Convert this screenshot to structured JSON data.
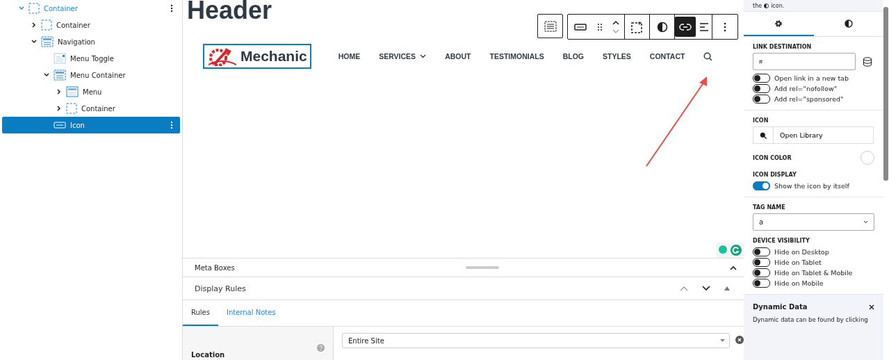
{
  "tree": [
    {
      "label": "Container",
      "kind": "container",
      "expanded": true,
      "selected": false,
      "children": [
        {
          "label": "Container",
          "kind": "container",
          "expanded": false,
          "selected": false
        },
        {
          "label": "Navigation",
          "kind": "navigation",
          "expanded": true,
          "selected": false,
          "children": [
            {
              "label": "Menu Toggle",
              "kind": "menu-toggle",
              "selected": false
            },
            {
              "label": "Menu Container",
              "kind": "navigation",
              "expanded": true,
              "selected": false,
              "children": [
                {
                  "label": "Menu",
                  "kind": "menu",
                  "expanded": false,
                  "selected": false
                },
                {
                  "label": "Container",
                  "kind": "container",
                  "expanded": false,
                  "selected": false
                }
              ]
            },
            {
              "label": "Icon",
              "kind": "icon",
              "selected": true
            }
          ]
        }
      ]
    }
  ],
  "canvas": {
    "heading": "Header",
    "toolbar": [
      {
        "kind": "navigation",
        "selected": false
      },
      {
        "kind": "icon-block",
        "selected": false
      },
      {
        "kind": "drag",
        "selected": false
      },
      {
        "kind": "move",
        "selected": false
      },
      {
        "kind": "select-parent",
        "selected": false
      },
      {
        "kind": "contrast",
        "selected": false
      },
      {
        "kind": "link",
        "selected": true
      },
      {
        "kind": "align",
        "selected": false
      },
      {
        "kind": "more",
        "selected": false
      }
    ],
    "logo": "Mechanic",
    "menu": [
      {
        "label": "HOME",
        "dropdown": false
      },
      {
        "label": "SERVICES",
        "dropdown": true
      },
      {
        "label": "ABOUT",
        "dropdown": false
      },
      {
        "label": "TESTIMONIALS",
        "dropdown": false
      },
      {
        "label": "BLOG",
        "dropdown": false
      },
      {
        "label": "STYLES",
        "dropdown": false
      },
      {
        "label": "CONTACT",
        "dropdown": false
      }
    ]
  },
  "meta_boxes": {
    "title": "Meta Boxes",
    "panel_title": "Display Rules",
    "tabs": [
      {
        "label": "Rules",
        "selected": true
      },
      {
        "label": "Internal Notes",
        "selected": false
      }
    ],
    "location_label": "Location",
    "location_value": "Entire Site"
  },
  "inspector": {
    "note_start": "the",
    "note_end": "icon.",
    "tabs": [
      {
        "kind": "settings",
        "selected": true
      },
      {
        "kind": "styles",
        "selected": false
      }
    ],
    "link_heading": "LINK DESTINATION",
    "link_value": "#",
    "link_toggles": [
      {
        "label": "Open link in a new tab",
        "on": false
      },
      {
        "label": "Add rel=\"nofollow\"",
        "on": false
      },
      {
        "label": "Add rel=\"sponsored\"",
        "on": false
      }
    ],
    "icon_heading": "ICON",
    "icon_button": "Open Library",
    "color_heading": "ICON COLOR",
    "display_heading": "ICON DISPLAY",
    "display_toggle": {
      "label": "Show the icon by itself",
      "on": true
    },
    "tag_heading": "TAG NAME",
    "tag_value": "a",
    "visibility_heading": "DEVICE VISIBILITY",
    "visibility_toggles": [
      {
        "label": "Hide on Desktop",
        "on": false
      },
      {
        "label": "Hide on Tablet",
        "on": false
      },
      {
        "label": "Hide on Tablet & Mobile",
        "on": false
      },
      {
        "label": "Hide on Mobile",
        "on": false
      }
    ],
    "dynamic_title": "Dynamic Data",
    "dynamic_text": "Dynamic data can be found by clicking"
  }
}
